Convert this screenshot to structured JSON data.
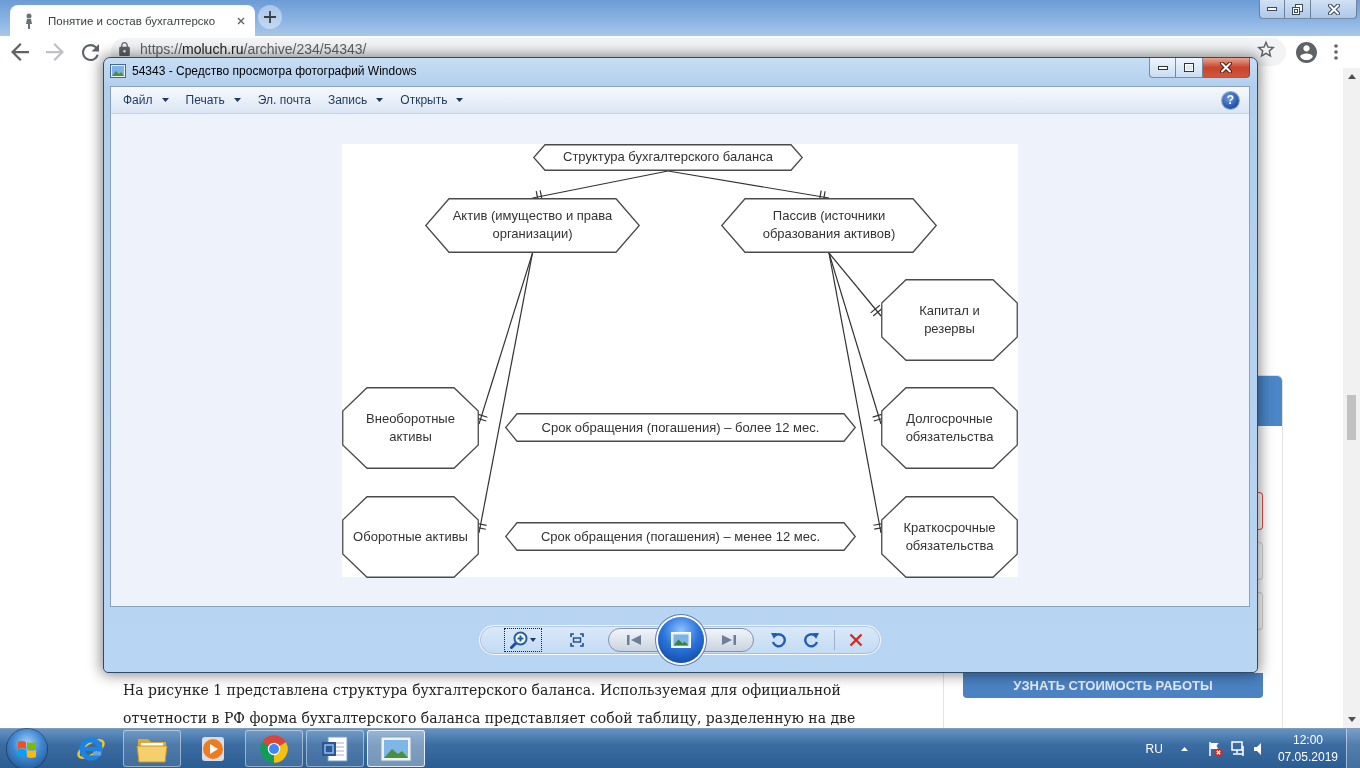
{
  "browser": {
    "tab": {
      "title": "Понятие и состав бухгалтерско",
      "selected": true
    },
    "address": "https://moluch.ru/archive/234/54343/"
  },
  "page": {
    "paragraph": "На рисунке 1 представлена структура бухгалтерского баланса. Используемая для официальной отчетности в РФ форма бухгалтерского баланса представляет собой таблицу, разделенную на две",
    "sidebar": {
      "fields": [
        {
          "invalid": true
        },
        {
          "invalid": false
        },
        {
          "invalid": false
        }
      ],
      "button": "УЗНАТЬ СТОИМОСТЬ РАБОТЫ"
    }
  },
  "viewer": {
    "title": "54343 - Средство просмотра фотографий Windows",
    "menu": [
      {
        "label": "Файл",
        "dropdown": true
      },
      {
        "label": "Печать",
        "dropdown": true
      },
      {
        "label": "Эл. почта",
        "dropdown": false
      },
      {
        "label": "Запись",
        "dropdown": true
      },
      {
        "label": "Открыть",
        "dropdown": true
      }
    ],
    "help": "?",
    "diagram": {
      "root": {
        "label": "Структура бухгалтерского баланса",
        "children": [
          {
            "label": "Актив (имущество и права организации)",
            "children": [
              {
                "label": "Внеоборотные активы"
              },
              {
                "label": "Оборотные активы"
              }
            ]
          },
          {
            "label": "Пассив (источники образования активов)",
            "children": [
              {
                "label": "Капитал и резервы"
              },
              {
                "label": "Долгосрочные обязательства"
              },
              {
                "label": "Краткосрочные обязательства"
              }
            ]
          }
        ]
      },
      "terms": [
        {
          "label": "Срок обращения (погашения) – более 12 мес."
        },
        {
          "label": "Срок обращения (погашения) – менее 12 мес."
        }
      ]
    }
  },
  "taskbar": {
    "apps": [
      {
        "kind": "browser_e",
        "running": false,
        "active": false
      },
      {
        "kind": "folder",
        "running": true,
        "active": false
      },
      {
        "kind": "player",
        "running": false,
        "active": false
      },
      {
        "kind": "browser_ring",
        "running": true,
        "active": false
      },
      {
        "kind": "document",
        "running": true,
        "active": false
      },
      {
        "kind": "photos",
        "running": true,
        "active": true
      }
    ],
    "tray": {
      "language": "RU",
      "time": "12:00",
      "date": "07.05.2019"
    }
  }
}
